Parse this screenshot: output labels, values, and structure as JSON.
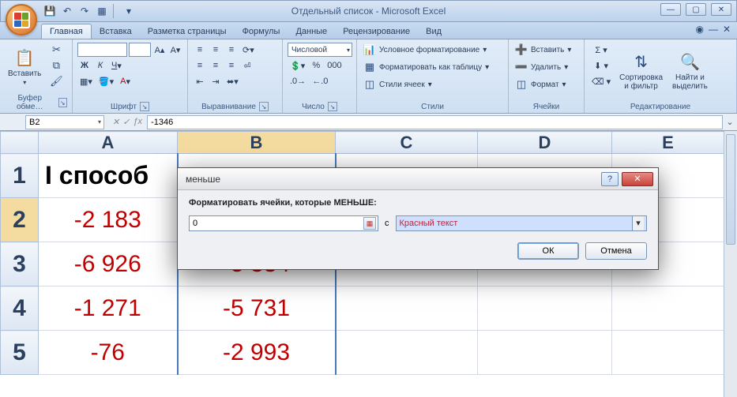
{
  "window": {
    "title": "Отдельный список - Microsoft Excel"
  },
  "qat": {
    "save": "💾",
    "undo": "↶",
    "redo": "↷",
    "styles": "▦"
  },
  "tabs": {
    "home": "Главная",
    "insert": "Вставка",
    "layout": "Разметка страницы",
    "formulas": "Формулы",
    "data": "Данные",
    "review": "Рецензирование",
    "view": "Вид"
  },
  "ribbon": {
    "clipboard": {
      "label": "Буфер обме…",
      "paste": "Вставить"
    },
    "font": {
      "label": "Шрифт",
      "name_ph": "",
      "size_ph": ""
    },
    "align": {
      "label": "Выравнивание"
    },
    "number": {
      "label": "Число",
      "format": "Числовой"
    },
    "styles": {
      "label": "Стили",
      "cond": "Условное форматирование",
      "table": "Форматировать как таблицу",
      "cell": "Стили ячеек"
    },
    "cells": {
      "label": "Ячейки",
      "insert": "Вставить",
      "delete": "Удалить",
      "format": "Формат"
    },
    "editing": {
      "label": "Редактирование",
      "sort": "Сортировка\nи фильтр",
      "find": "Найти и\nвыделить"
    }
  },
  "formula_bar": {
    "name_box": "B2",
    "formula": "-1346"
  },
  "columns": [
    "A",
    "B",
    "C",
    "D",
    "E"
  ],
  "rows": [
    "1",
    "2",
    "3",
    "4",
    "5"
  ],
  "cells": {
    "A1": "I способ",
    "A2": "-2 183",
    "A3": "-6 926",
    "A4": "-1 271",
    "A5": "-76",
    "B3": "-5 334",
    "B4": "-5 731",
    "B5": "-2 993"
  },
  "dialog": {
    "title": "меньше",
    "label": "Форматировать ячейки, которые МЕНЬШЕ:",
    "value": "0",
    "mid": "с",
    "select": "Красный текст",
    "ok": "ОК",
    "cancel": "Отмена"
  },
  "chart_data": {
    "type": "table",
    "title": "I способ",
    "columns": [
      "A",
      "B"
    ],
    "rows": [
      {
        "A": -2183,
        "B": null
      },
      {
        "A": -6926,
        "B": -5334
      },
      {
        "A": -1271,
        "B": -5731
      },
      {
        "A": -76,
        "B": -2993
      }
    ],
    "note": "B2 raw value shown in formula bar = -1346; cells displayed with red text via conditional formatting (< 0)."
  }
}
